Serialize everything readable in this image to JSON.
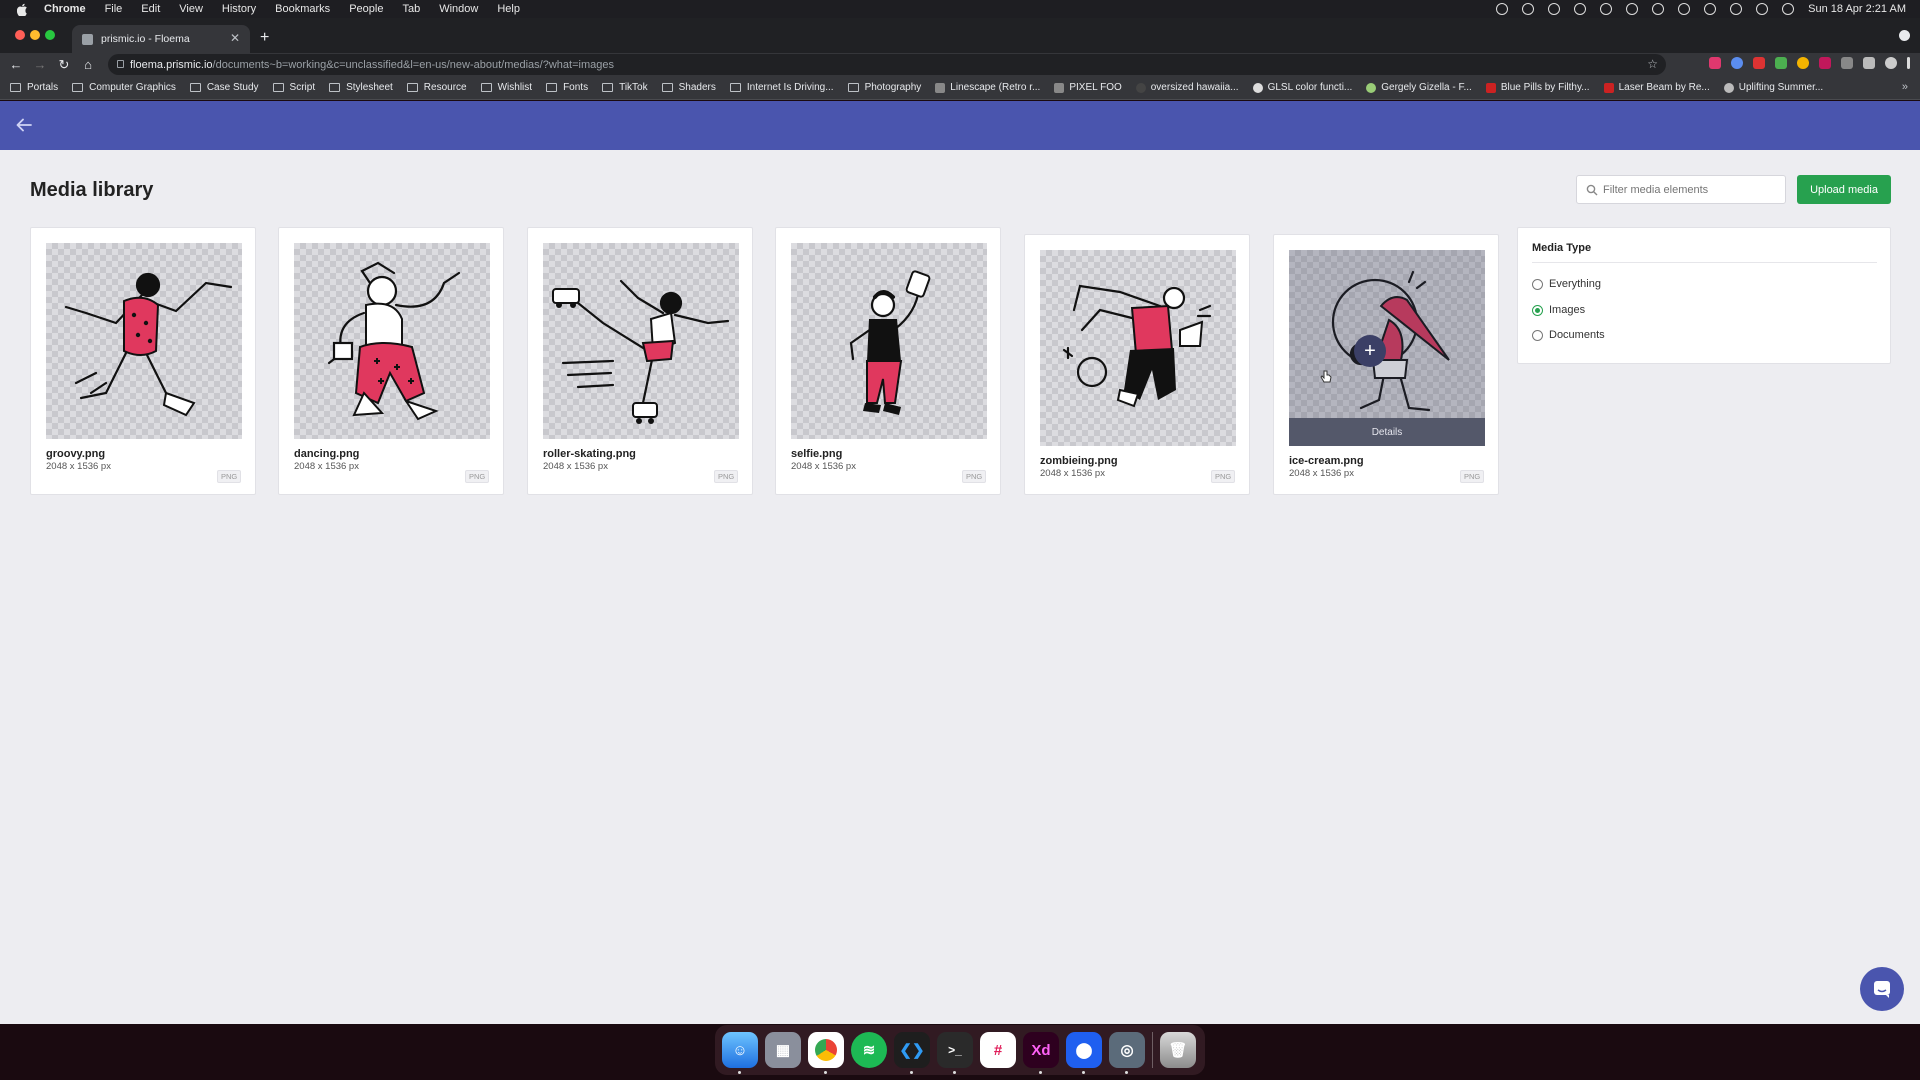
{
  "menubar": {
    "items": [
      "Chrome",
      "File",
      "Edit",
      "View",
      "History",
      "Bookmarks",
      "People",
      "Tab",
      "Window",
      "Help"
    ],
    "clock": "Sun 18 Apr  2:21 AM"
  },
  "browser": {
    "tab_title": "prismic.io - Floema",
    "url_host": "floema.prismic.io",
    "url_path": "/documents~b=working&c=unclassified&l=en-us/new-about/medias/?what=images",
    "bookmarks": [
      "Portals",
      "Computer Graphics",
      "Case Study",
      "Script",
      "Stylesheet",
      "Resource",
      "Wishlist",
      "Fonts",
      "TikTok",
      "Shaders",
      "Internet Is Driving...",
      "Photography",
      "Linescape (Retro r...",
      "PIXEL FOO",
      "oversized hawaiia...",
      "GLSL color functi...",
      "Gergely Gizella - F...",
      "Blue Pills by Filthy...",
      "Laser Beam by Re...",
      "Uplifting Summer..."
    ]
  },
  "page": {
    "title": "Media library",
    "search_placeholder": "Filter media elements",
    "upload_label": "Upload media",
    "hover_details_label": "Details"
  },
  "media": [
    {
      "name": "groovy.png",
      "dims": "2048 x 1536 px",
      "type": "PNG"
    },
    {
      "name": "dancing.png",
      "dims": "2048 x 1536 px",
      "type": "PNG"
    },
    {
      "name": "roller-skating.png",
      "dims": "2048 x 1536 px",
      "type": "PNG"
    },
    {
      "name": "selfie.png",
      "dims": "2048 x 1536 px",
      "type": "PNG"
    },
    {
      "name": "zombieing.png",
      "dims": "2048 x 1536 px",
      "type": "PNG"
    },
    {
      "name": "ice-cream.png",
      "dims": "2048 x 1536 px",
      "type": "PNG"
    }
  ],
  "filter": {
    "title": "Media Type",
    "options": [
      {
        "label": "Everything",
        "selected": false
      },
      {
        "label": "Images",
        "selected": true
      },
      {
        "label": "Documents",
        "selected": false
      }
    ]
  },
  "colors": {
    "header": "#4a55ae",
    "accent_green": "#27a14f",
    "illustration_red": "#e0385e"
  }
}
